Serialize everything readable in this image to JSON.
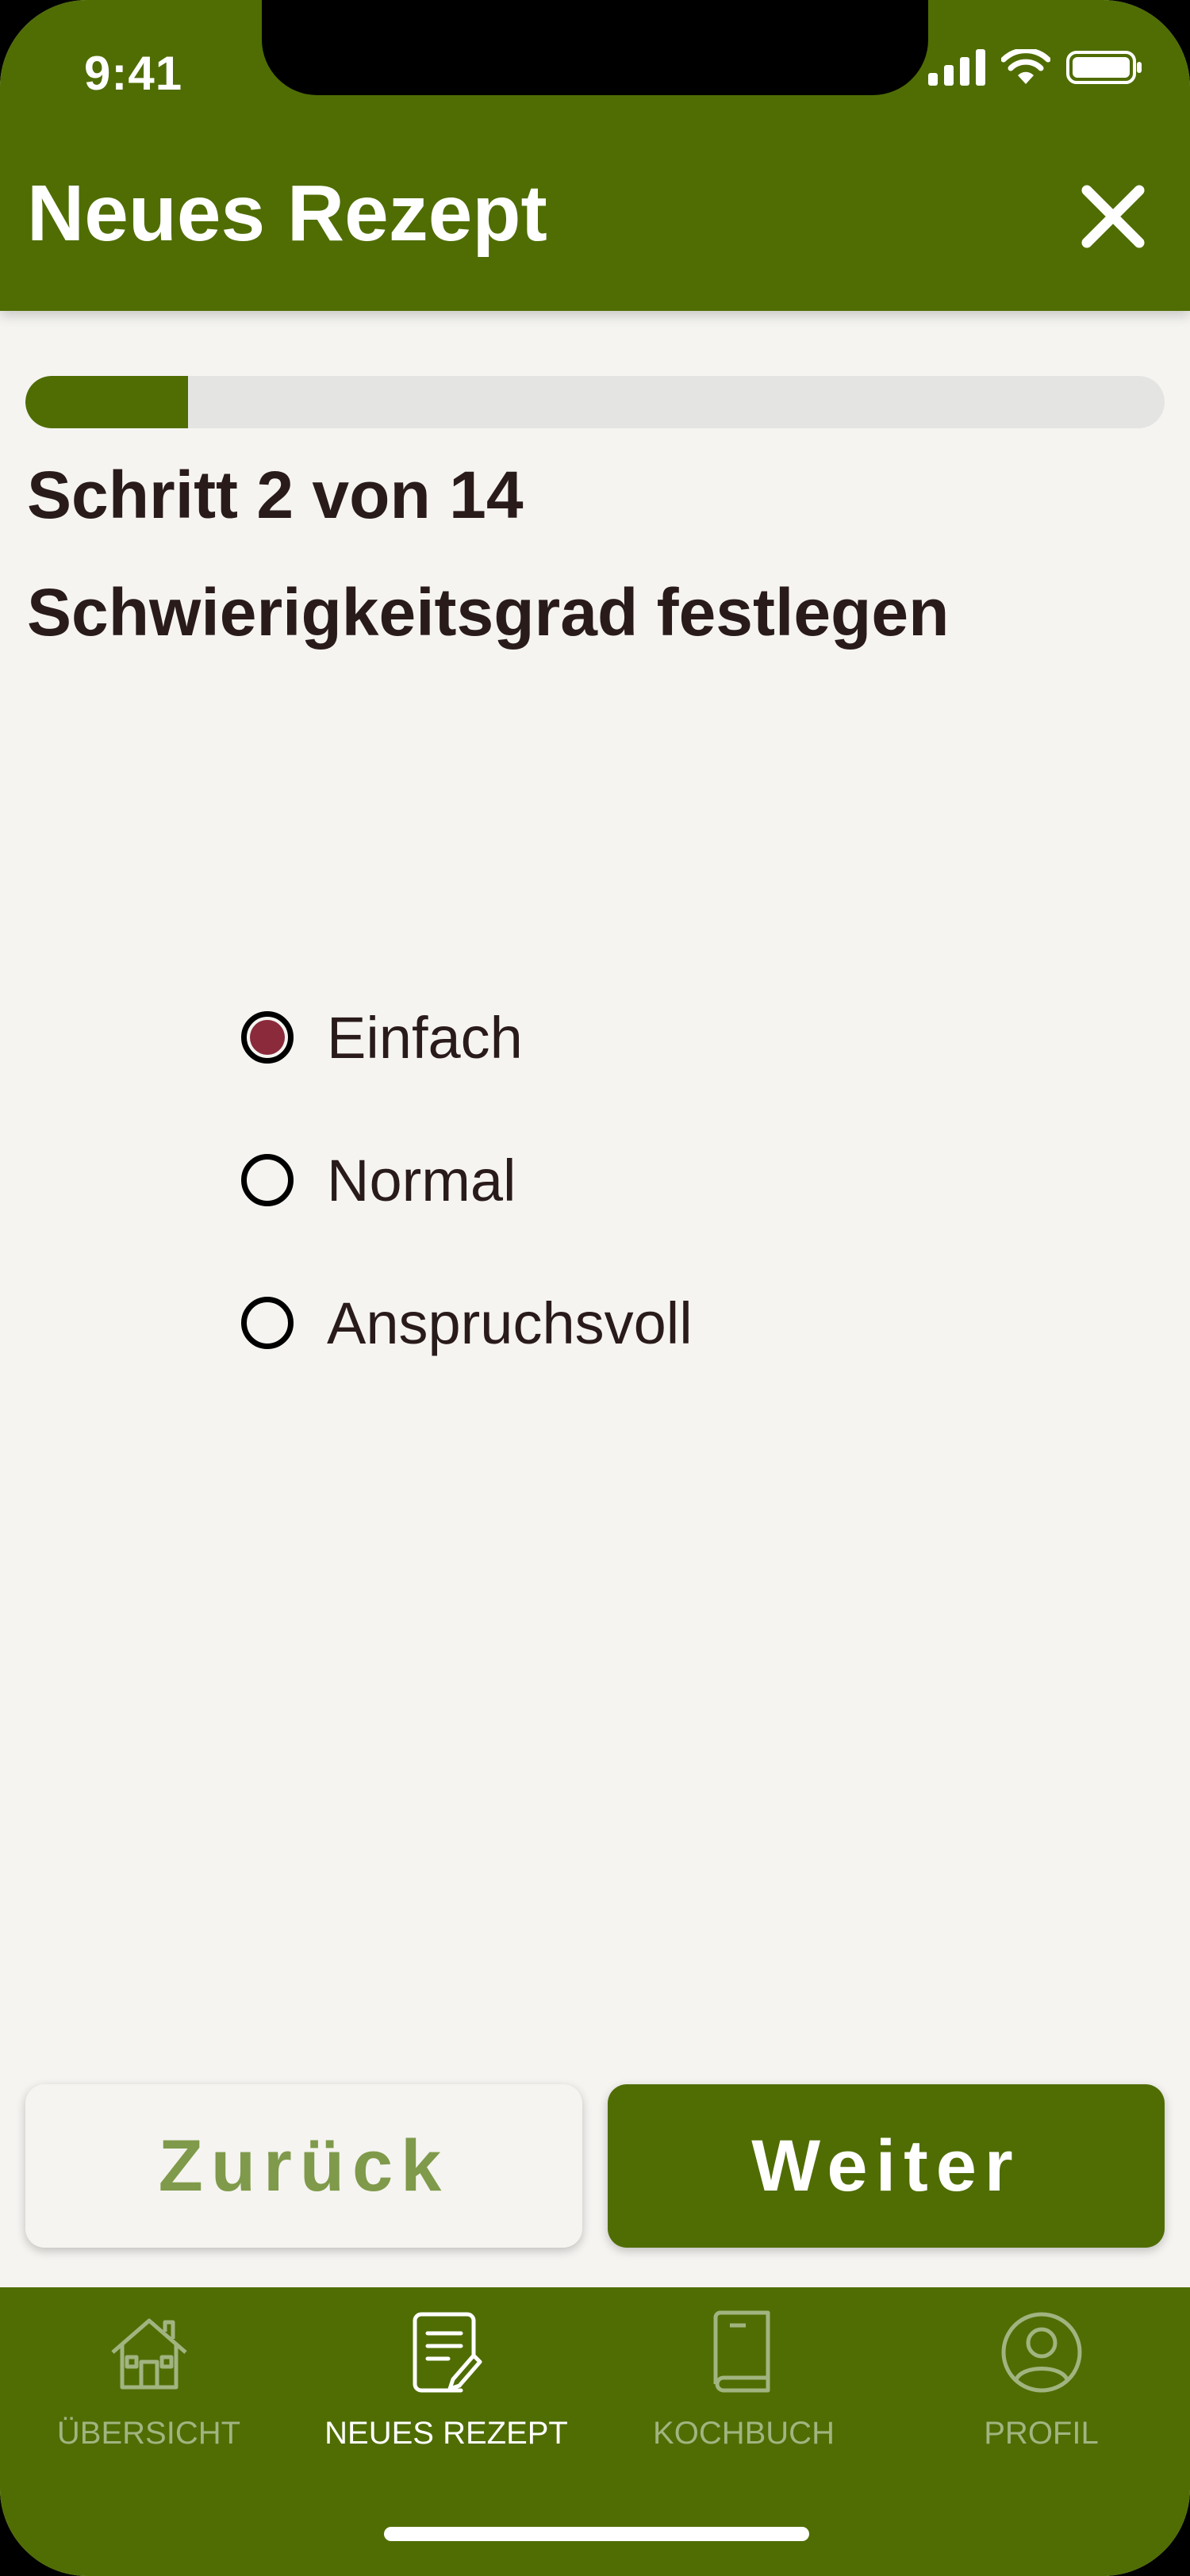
{
  "status_bar": {
    "time": "9:41"
  },
  "header": {
    "title": "Neues Rezept",
    "close_icon": "close-icon"
  },
  "progress": {
    "current_step": 2,
    "total_steps": 14,
    "fraction": 0.143
  },
  "step_label": "Schritt 2 von 14",
  "subtitle": "Schwierigkeitsgrad festlegen",
  "difficulty": {
    "selected": "Einfach",
    "options": [
      {
        "label": "Einfach",
        "checked": true
      },
      {
        "label": "Normal",
        "checked": false
      },
      {
        "label": "Anspruchsvoll",
        "checked": false
      }
    ]
  },
  "buttons": {
    "back": "Zurück",
    "next": "Weiter"
  },
  "tabbar": {
    "items": [
      {
        "label": "ÜBERSICHT",
        "icon": "house-icon",
        "active": false
      },
      {
        "label": "NEUES REZEPT",
        "icon": "recipe-edit-icon",
        "active": true
      },
      {
        "label": "KOCHBUCH",
        "icon": "book-icon",
        "active": false
      },
      {
        "label": "PROFIL",
        "icon": "user-icon",
        "active": false
      }
    ]
  },
  "colors": {
    "primary": "#4f6d03",
    "selected_radio": "#8a2a3a",
    "background": "#f5f4f1"
  }
}
